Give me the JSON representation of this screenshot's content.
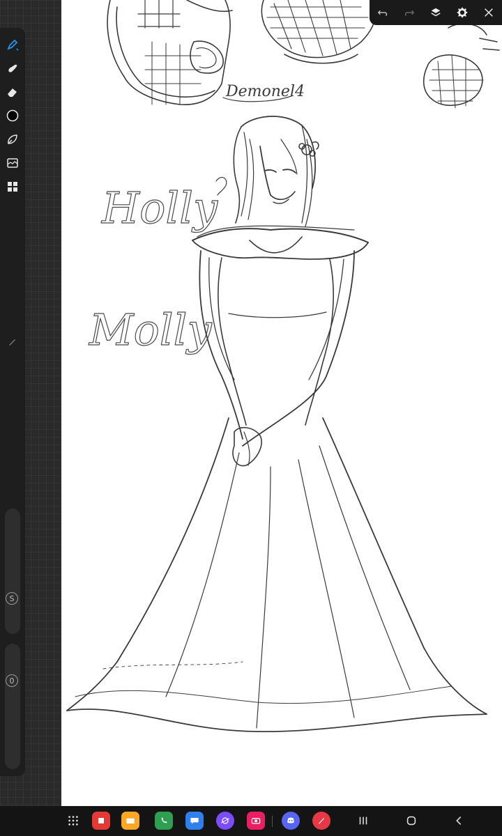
{
  "canvas": {
    "signature": "Demonel4",
    "name_1": "Holly",
    "name_2": "Molly"
  },
  "toolbar": {
    "tools": [
      {
        "name": "brush-tool",
        "icon": "pen-icon",
        "active": true
      },
      {
        "name": "smudge-tool",
        "icon": "smudge-icon"
      },
      {
        "name": "eraser-tool",
        "icon": "eraser-icon"
      },
      {
        "name": "color-tool",
        "icon": "color-circle-icon"
      },
      {
        "name": "lasso-tool",
        "icon": "lasso-icon"
      },
      {
        "name": "adjust-tool",
        "icon": "image-adjust-icon"
      },
      {
        "name": "gallery-tool",
        "icon": "grid-icon"
      }
    ],
    "size_label": "S",
    "opacity_label": "0"
  },
  "topbar": {
    "actions": [
      "undo-icon",
      "redo-icon",
      "layers-icon",
      "settings-icon",
      "close-icon"
    ]
  },
  "taskbar": {
    "apps": [
      {
        "name": "app-grid",
        "color": "#141414"
      },
      {
        "name": "flip-app",
        "color": "#e53935"
      },
      {
        "name": "files-app",
        "color": "#f9a825"
      },
      {
        "name": "phone-app",
        "color": "#2e9e4f"
      },
      {
        "name": "messages-app",
        "color": "#2f80ed"
      },
      {
        "name": "browser-app",
        "color": "#7c4dff"
      },
      {
        "name": "camera-app",
        "color": "#e91e63"
      },
      {
        "name": "discord-app",
        "color": "#5865f2"
      },
      {
        "name": "sketch-app",
        "color": "#e53945"
      }
    ]
  },
  "colors": {
    "accent": "#2196f3",
    "toolbar_bg": "#1e1e1e",
    "canvas_bg": "#ffffff"
  }
}
